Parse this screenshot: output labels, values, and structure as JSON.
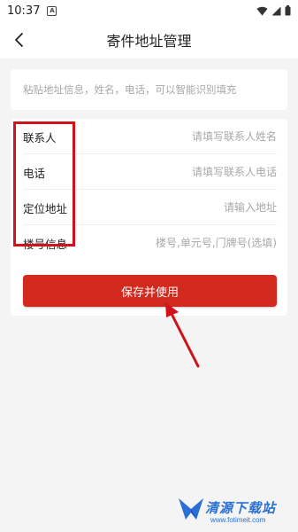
{
  "status_bar": {
    "time": "10:37",
    "notification_icon": "a-icon",
    "icons": [
      "wifi-icon",
      "signal-icon",
      "battery-icon"
    ]
  },
  "header": {
    "title": "寄件地址管理",
    "back_icon": "chevron-left-icon"
  },
  "paste_field": {
    "placeholder": "粘贴地址信息，姓名，电话，可以智能识别填充"
  },
  "form": {
    "rows": [
      {
        "label": "联系人",
        "placeholder": "请填写联系人姓名"
      },
      {
        "label": "电话",
        "placeholder": "请填写联系人电话"
      },
      {
        "label": "定位地址",
        "placeholder": "请输入地址"
      },
      {
        "label": "楼号信息",
        "placeholder": "楼号,单元号,门牌号(选填)"
      }
    ]
  },
  "save_button": {
    "label": "保存并使用"
  },
  "colors": {
    "accent": "#d32a20",
    "annotation": "#d1111b",
    "background": "#f4f4f4",
    "watermark": "#2a6fd6"
  },
  "watermark": {
    "name": "清源下载站",
    "url": "www.fotimeit.com"
  }
}
